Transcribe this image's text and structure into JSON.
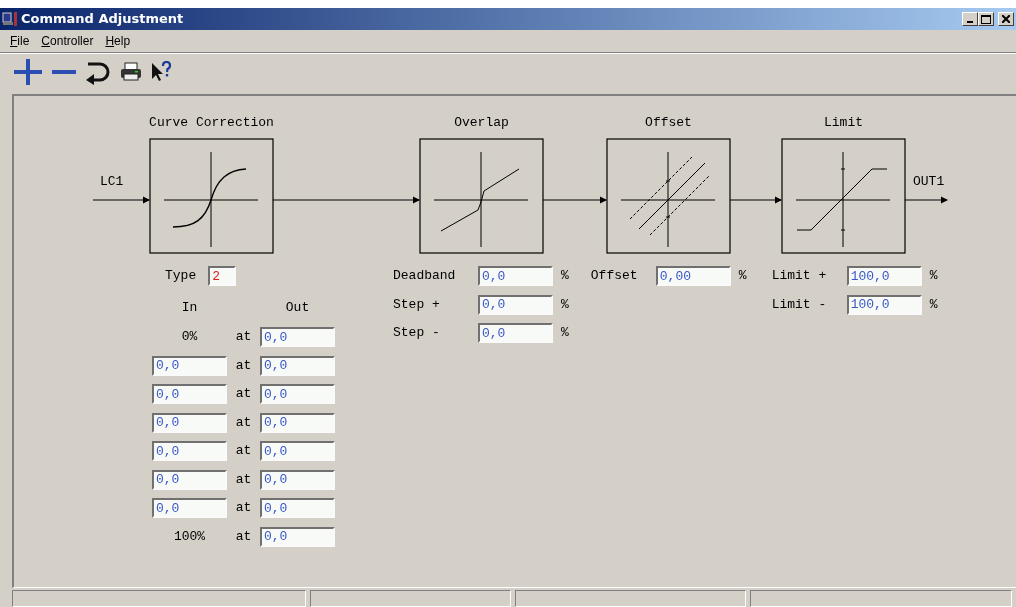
{
  "window": {
    "title": "Command Adjustment"
  },
  "menu": [
    {
      "label": "File",
      "first_letter_underlined": true
    },
    {
      "label": "Controller",
      "first_letter_underlined": true
    },
    {
      "label": "Help",
      "first_letter_underlined": true
    }
  ],
  "toolbar": [
    {
      "kind": "add"
    },
    {
      "kind": "remove"
    },
    {
      "kind": "return"
    },
    {
      "kind": "print"
    },
    {
      "kind": "help"
    }
  ],
  "diagram": {
    "input_label": "LC1",
    "output_label": "OUT1",
    "blocks": [
      {
        "title": "Curve Correction",
        "kind": "curve"
      },
      {
        "title": "Overlap",
        "kind": "overlap"
      },
      {
        "title": "Offset",
        "kind": "offset"
      },
      {
        "title": "Limit",
        "kind": "limit"
      }
    ]
  },
  "curve_correction": {
    "type_label": "Type",
    "type_value": "2",
    "in_heading": "In",
    "out_heading": "Out",
    "rows": [
      {
        "kind": "fixed",
        "in": "0%",
        "at": "at",
        "out": "0,0"
      },
      {
        "kind": "field",
        "in": "0,0",
        "at": "at",
        "out": "0,0"
      },
      {
        "kind": "field",
        "in": "0,0",
        "at": "at",
        "out": "0,0"
      },
      {
        "kind": "field",
        "in": "0,0",
        "at": "at",
        "out": "0,0"
      },
      {
        "kind": "field",
        "in": "0,0",
        "at": "at",
        "out": "0,0"
      },
      {
        "kind": "field",
        "in": "0,0",
        "at": "at",
        "out": "0,0"
      },
      {
        "kind": "field",
        "in": "0,0",
        "at": "at",
        "out": "0,0"
      },
      {
        "kind": "fixed",
        "in": "100%",
        "at": "at",
        "out": "0,0"
      }
    ]
  },
  "overlap": [
    {
      "label": "Deadband",
      "value": "0,0",
      "unit": "%"
    },
    {
      "label": "Step +",
      "value": "0,0",
      "unit": "%"
    },
    {
      "label": "Step -",
      "value": "0,0",
      "unit": "%"
    }
  ],
  "offset": [
    {
      "label": "Offset",
      "value": "0,00",
      "unit": "%"
    }
  ],
  "limit": [
    {
      "label": "Limit +",
      "value": "100,0",
      "unit": "%"
    },
    {
      "label": "Limit -",
      "value": "100,0",
      "unit": "%"
    }
  ]
}
